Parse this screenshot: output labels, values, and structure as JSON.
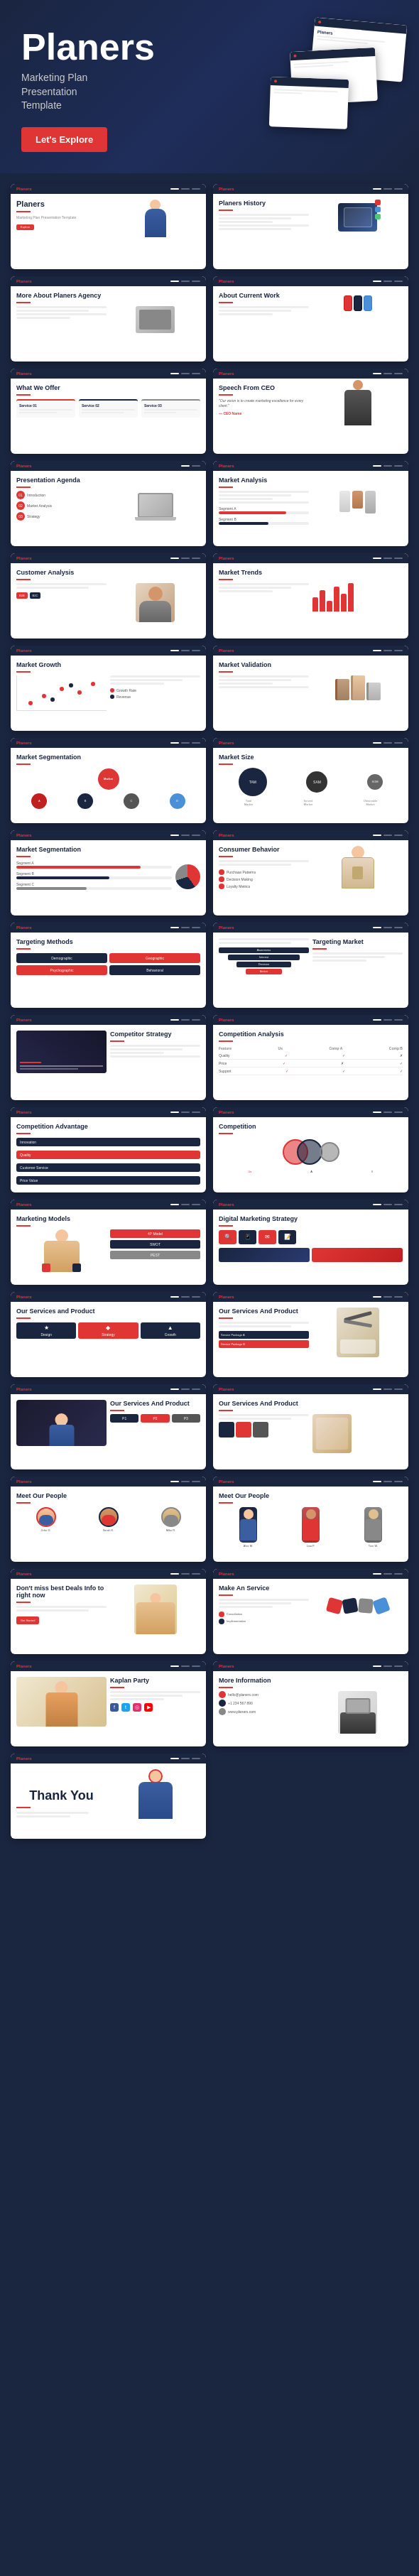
{
  "hero": {
    "title": "Planers",
    "subtitle": "Marketing Plan\nPresentation\nTemplate",
    "explore_btn": "Let's Explore"
  },
  "slides": [
    {
      "id": 1,
      "title": "Planers",
      "type": "cover"
    },
    {
      "id": 2,
      "title": "Planers History",
      "type": "history"
    },
    {
      "id": 3,
      "title": "More About Planers Agency",
      "type": "about"
    },
    {
      "id": 4,
      "title": "About Current Work",
      "type": "current_work"
    },
    {
      "id": 5,
      "title": "What We Offer",
      "type": "offer"
    },
    {
      "id": 6,
      "title": "Speech From CEO",
      "type": "ceo"
    },
    {
      "id": 7,
      "title": "Presentation Agenda",
      "type": "agenda"
    },
    {
      "id": 8,
      "title": "Market Analysis",
      "type": "market_analysis"
    },
    {
      "id": 9,
      "title": "Customer Analysis",
      "type": "customer"
    },
    {
      "id": 10,
      "title": "Market Trends",
      "type": "trends"
    },
    {
      "id": 11,
      "title": "Market Growth",
      "type": "growth"
    },
    {
      "id": 12,
      "title": "Market Validation",
      "type": "validation"
    },
    {
      "id": 13,
      "title": "Market Segmentation",
      "type": "segmentation"
    },
    {
      "id": 14,
      "title": "Market Size",
      "type": "market_size"
    },
    {
      "id": 15,
      "title": "Market Segmentation 2",
      "type": "segmentation2"
    },
    {
      "id": 16,
      "title": "Consumer Behavior",
      "type": "consumer"
    },
    {
      "id": 17,
      "title": "Targeting Methods",
      "type": "targeting"
    },
    {
      "id": 18,
      "title": "Targeting Market",
      "type": "target_market"
    },
    {
      "id": 19,
      "title": "Competitor Strategy",
      "type": "comp_strategy"
    },
    {
      "id": 20,
      "title": "Competition Analysis",
      "type": "comp_analysis"
    },
    {
      "id": 21,
      "title": "Competition Advantage",
      "type": "comp_adv"
    },
    {
      "id": 22,
      "title": "Competition",
      "type": "competition"
    },
    {
      "id": 23,
      "title": "Marketing Models",
      "type": "mkt_models"
    },
    {
      "id": 24,
      "title": "Digital Marketing Strategy",
      "type": "digital"
    },
    {
      "id": 25,
      "title": "Our Services and Product",
      "type": "services"
    },
    {
      "id": 26,
      "title": "Our Services and Product 2",
      "type": "services2"
    },
    {
      "id": 27,
      "title": "Our Services And Product 3",
      "type": "services3"
    },
    {
      "id": 28,
      "title": "Our Services And Product 4",
      "type": "services4"
    },
    {
      "id": 29,
      "title": "Meet Our People",
      "type": "people"
    },
    {
      "id": 30,
      "title": "Meet Our People 2",
      "type": "people2"
    },
    {
      "id": 31,
      "title": "Don't miss best Deals Info",
      "type": "deals"
    },
    {
      "id": 32,
      "title": "Make An Service",
      "type": "service"
    },
    {
      "id": 33,
      "title": "Kaplan Party",
      "type": "kaplan"
    },
    {
      "id": 34,
      "title": "More Information",
      "type": "more_info"
    },
    {
      "id": 35,
      "title": "Thank You",
      "type": "thankyou"
    }
  ]
}
